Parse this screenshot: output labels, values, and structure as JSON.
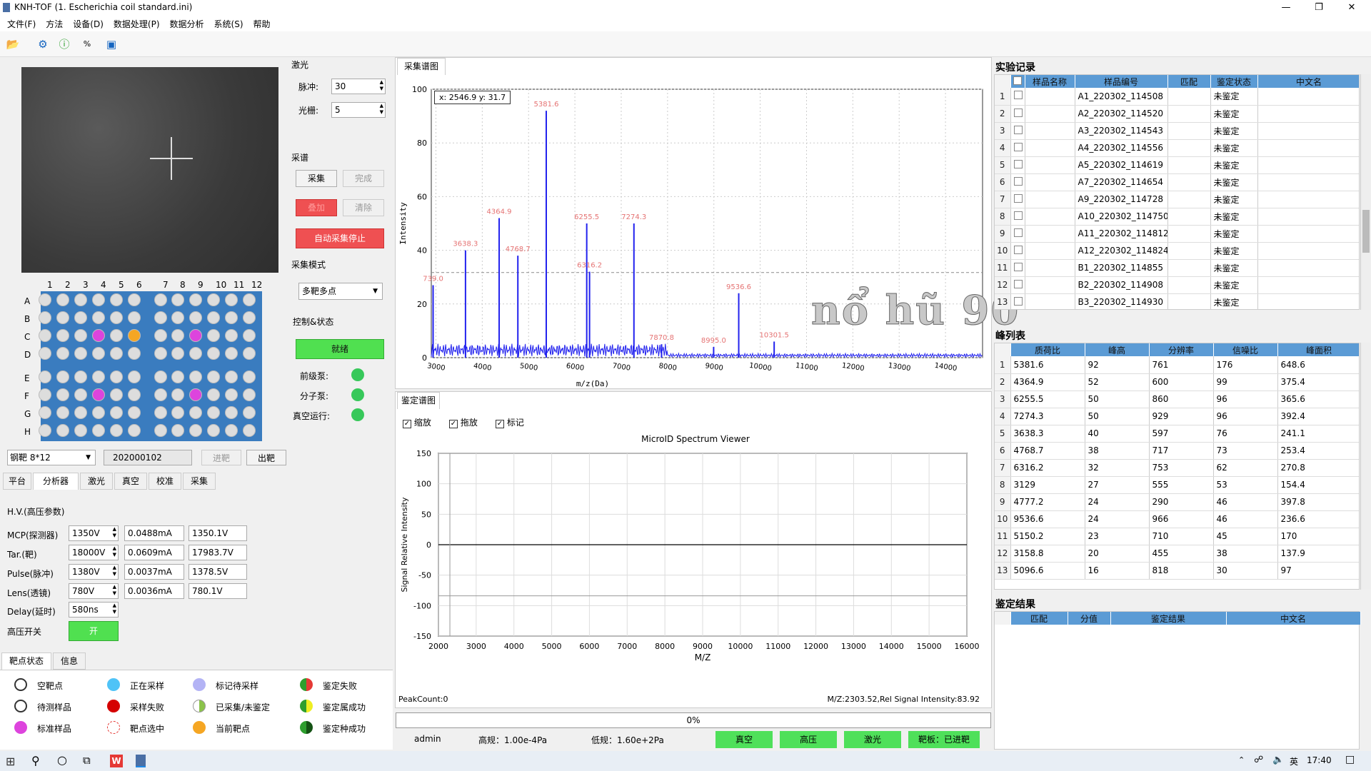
{
  "window": {
    "title": "KNH-TOF (1. Escherichia coil standard.ini)"
  },
  "menu": [
    "文件(F)",
    "方法",
    "设备(D)",
    "数据处理(P)",
    "数据分析",
    "系统(S)",
    "帮助"
  ],
  "plate": {
    "cols": [
      "1",
      "2",
      "3",
      "4",
      "5",
      "6",
      "7",
      "8",
      "9",
      "10",
      "11",
      "12"
    ],
    "rows": [
      "A",
      "B",
      "C",
      "D",
      "E",
      "F",
      "G",
      "H"
    ],
    "type": "钢靶 8*12",
    "code": "202000102",
    "load_btn": "进靶",
    "unload_btn": "出靶",
    "colors": {
      "plate": "#3a7cbf",
      "empty": "#dddddd",
      "standard": "#dd44dd",
      "current": "#f5a623"
    }
  },
  "laser": {
    "section": "激光",
    "pulse_label": "脉冲:",
    "pulse_value": "30",
    "grating_label": "光栅:",
    "grating_value": "5"
  },
  "acq": {
    "section": "采谱",
    "collect": "采集",
    "finish": "完成",
    "add": "叠加",
    "clear": "清除",
    "auto_stop": "自动采集停止"
  },
  "mode": {
    "section": "采集模式",
    "value": "多靶多点"
  },
  "control": {
    "section": "控制&状态",
    "ready": "就绪",
    "pre_pump": "前级泵:",
    "mol_pump": "分子泵:",
    "vacuum": "真空运行:"
  },
  "bottom_tabs": [
    "平台",
    "分析器",
    "激光",
    "真空",
    "校准",
    "采集"
  ],
  "hv": {
    "title": "H.V.(高压参数)",
    "rows": [
      {
        "label": "MCP(探测器)",
        "set": "1350V",
        "current": "0.0488mA",
        "actual": "1350.1V"
      },
      {
        "label": "Tar.(靶)",
        "set": "18000V",
        "current": "0.0609mA",
        "actual": "17983.7V"
      },
      {
        "label": "Pulse(脉冲)",
        "set": "1380V",
        "current": "0.0037mA",
        "actual": "1378.5V"
      },
      {
        "label": "Lens(透镜)",
        "set": "780V",
        "current": "0.0036mA",
        "actual": "780.1V"
      }
    ],
    "delay_label": "Delay(延时)",
    "delay_value": "580ns",
    "switch_label": "高压开关",
    "switch_btn": "开"
  },
  "legend_tabs": [
    "靶点状态",
    "信息"
  ],
  "legend": [
    {
      "label": "空靶点",
      "color": "#ffffff"
    },
    {
      "label": "正在采样",
      "color": "#4fc3f7"
    },
    {
      "label": "标记待采样",
      "color": "#b3b3f5"
    },
    {
      "label": "鉴定失败",
      "color": "#e53935"
    },
    {
      "label": "待测样品",
      "color": "#ffffff"
    },
    {
      "label": "采样失败",
      "color": "#d50000"
    },
    {
      "label": "已采集/未鉴定",
      "color": "#8bc34a"
    },
    {
      "label": "鉴定属成功",
      "color": "#eeee22"
    },
    {
      "label": "标准样品",
      "color": "#dd44dd"
    },
    {
      "label": "靶点选中",
      "color": "#ffffff"
    },
    {
      "label": "当前靶点",
      "color": "#f5a623"
    },
    {
      "label": "鉴定种成功",
      "color": "#2e9e2e"
    }
  ],
  "spectrum_tab": "采集谱图",
  "spectrum_readout": "x: 2546.9  y: 31.7",
  "chart_data": [
    {
      "type": "line",
      "title": "",
      "xlabel": "m/z(Da)",
      "ylabel": "Intensity",
      "xlim": [
        2900,
        14800
      ],
      "ylim": [
        0,
        100
      ],
      "xticks": [
        3000,
        4000,
        5000,
        6000,
        7000,
        8000,
        9000,
        10000,
        11000,
        12000,
        13000,
        14000
      ],
      "yticks": [
        0,
        20,
        40,
        60,
        80,
        100
      ],
      "threshold": 31.7,
      "peaks": [
        {
          "x": 2939,
          "y": 27,
          "label": "739.0"
        },
        {
          "x": 3638.3,
          "y": 40,
          "label": "3638.3"
        },
        {
          "x": 4364.9,
          "y": 52,
          "label": "4364.9"
        },
        {
          "x": 4768.7,
          "y": 38,
          "label": "4768.7"
        },
        {
          "x": 5381.6,
          "y": 92,
          "label": "5381.6"
        },
        {
          "x": 6255.5,
          "y": 50,
          "label": "6255.5"
        },
        {
          "x": 6316.2,
          "y": 32,
          "label": "6316.2"
        },
        {
          "x": 7274.3,
          "y": 50,
          "label": "7274.3"
        },
        {
          "x": 7870.8,
          "y": 5,
          "label": "7870.8"
        },
        {
          "x": 8995.0,
          "y": 4,
          "label": "8995.0"
        },
        {
          "x": 9536.6,
          "y": 24,
          "label": "9536.6"
        },
        {
          "x": 10301.5,
          "y": 6,
          "label": "10301.5"
        }
      ]
    },
    {
      "type": "line",
      "title": "MicroID Spectrum Viewer",
      "xlabel": "M/Z",
      "ylabel": "Signal Relative Intensity",
      "xlim": [
        2000,
        16000
      ],
      "ylim": [
        -150,
        150
      ],
      "xticks": [
        2000,
        3000,
        4000,
        5000,
        6000,
        7000,
        8000,
        9000,
        10000,
        11000,
        12000,
        13000,
        14000,
        15000,
        16000
      ],
      "yticks": [
        150,
        100,
        50,
        0,
        -50,
        -100,
        -150
      ],
      "series": []
    }
  ],
  "ident": {
    "tab": "鉴定谱图",
    "checks": [
      "缩放",
      "拖放",
      "标记"
    ],
    "peak_count": "PeakCount:0",
    "readout": "M/Z:2303.52,Rel Signal Intensity:83.92",
    "progress": "0%"
  },
  "watermark": "nổ hũ 90",
  "records": {
    "title": "实验记录",
    "headers": [
      "样品名称",
      "样品编号",
      "匹配",
      "鉴定状态",
      "中文名"
    ],
    "rows": [
      [
        "",
        "A1_220302_114508",
        "",
        "未鉴定",
        ""
      ],
      [
        "",
        "A2_220302_114520",
        "",
        "未鉴定",
        ""
      ],
      [
        "",
        "A3_220302_114543",
        "",
        "未鉴定",
        ""
      ],
      [
        "",
        "A4_220302_114556",
        "",
        "未鉴定",
        ""
      ],
      [
        "",
        "A5_220302_114619",
        "",
        "未鉴定",
        ""
      ],
      [
        "",
        "A7_220302_114654",
        "",
        "未鉴定",
        ""
      ],
      [
        "",
        "A9_220302_114728",
        "",
        "未鉴定",
        ""
      ],
      [
        "",
        "A10_220302_114750",
        "",
        "未鉴定",
        ""
      ],
      [
        "",
        "A11_220302_114812",
        "",
        "未鉴定",
        ""
      ],
      [
        "",
        "A12_220302_114824",
        "",
        "未鉴定",
        ""
      ],
      [
        "",
        "B1_220302_114855",
        "",
        "未鉴定",
        ""
      ],
      [
        "",
        "B2_220302_114908",
        "",
        "未鉴定",
        ""
      ],
      [
        "",
        "B3_220302_114930",
        "",
        "未鉴定",
        ""
      ]
    ]
  },
  "peaks_table": {
    "title": "峰列表",
    "headers": [
      "质荷比",
      "峰高",
      "分辨率",
      "信噪比",
      "峰面积"
    ],
    "rows": [
      [
        "5381.6",
        "92",
        "761",
        "176",
        "648.6"
      ],
      [
        "4364.9",
        "52",
        "600",
        "99",
        "375.4"
      ],
      [
        "6255.5",
        "50",
        "860",
        "96",
        "365.6"
      ],
      [
        "7274.3",
        "50",
        "929",
        "96",
        "392.4"
      ],
      [
        "3638.3",
        "40",
        "597",
        "76",
        "241.1"
      ],
      [
        "4768.7",
        "38",
        "717",
        "73",
        "253.4"
      ],
      [
        "6316.2",
        "32",
        "753",
        "62",
        "270.8"
      ],
      [
        "3129",
        "27",
        "555",
        "53",
        "154.4"
      ],
      [
        "4777.2",
        "24",
        "290",
        "46",
        "397.8"
      ],
      [
        "9536.6",
        "24",
        "966",
        "46",
        "236.6"
      ],
      [
        "5150.2",
        "23",
        "710",
        "45",
        "170"
      ],
      [
        "3158.8",
        "20",
        "455",
        "38",
        "137.9"
      ],
      [
        "5096.6",
        "16",
        "818",
        "30",
        "97"
      ]
    ]
  },
  "result": {
    "title": "鉴定结果",
    "headers": [
      "匹配",
      "分值",
      "鉴定结果",
      "中文名"
    ]
  },
  "status": {
    "user": "admin",
    "high": "高规：1.00e-4Pa",
    "low": "低规：1.60e+2Pa",
    "segments": [
      "真空",
      "高压",
      "激光",
      "靶板：已进靶"
    ]
  },
  "taskbar": {
    "time": "17:40",
    "ime": "英"
  }
}
